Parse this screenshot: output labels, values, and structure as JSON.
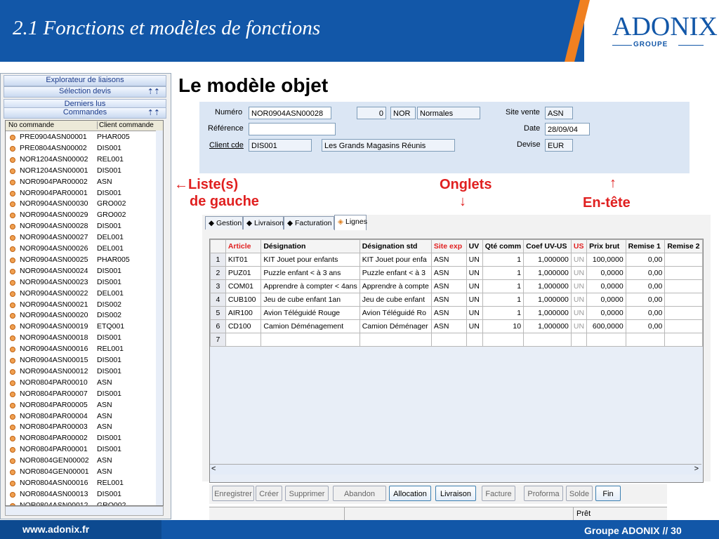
{
  "header": {
    "title": "2.1 Fonctions et modèles de fonctions",
    "logo": "ADONIX",
    "logo_sub": "GROUPE"
  },
  "footer": {
    "url": "www.adonix.fr",
    "right": "Groupe ADONIX // 30"
  },
  "left_panel": {
    "bar1": "Explorateur de liaisons",
    "bar2": "Sélection devis",
    "bar3": "Derniers lus",
    "bar4": "Commandes",
    "columns": [
      "No commande",
      "Client commande"
    ],
    "rows": [
      [
        "PRE0904ASN00001",
        "PHAR005"
      ],
      [
        "PRE0804ASN00002",
        "DIS001"
      ],
      [
        "NOR1204ASN00002",
        "REL001"
      ],
      [
        "NOR1204ASN00001",
        "DIS001"
      ],
      [
        "NOR0904PAR00002",
        "ASN"
      ],
      [
        "NOR0904PAR00001",
        "DIS001"
      ],
      [
        "NOR0904ASN00030",
        "GRO002"
      ],
      [
        "NOR0904ASN00029",
        "GRO002"
      ],
      [
        "NOR0904ASN00028",
        "DIS001"
      ],
      [
        "NOR0904ASN00027",
        "DEL001"
      ],
      [
        "NOR0904ASN00026",
        "DEL001"
      ],
      [
        "NOR0904ASN00025",
        "PHAR005"
      ],
      [
        "NOR0904ASN00024",
        "DIS001"
      ],
      [
        "NOR0904ASN00023",
        "DIS001"
      ],
      [
        "NOR0904ASN00022",
        "DEL001"
      ],
      [
        "NOR0904ASN00021",
        "DIS002"
      ],
      [
        "NOR0904ASN00020",
        "DIS002"
      ],
      [
        "NOR0904ASN00019",
        "ETQ001"
      ],
      [
        "NOR0904ASN00018",
        "DIS001"
      ],
      [
        "NOR0904ASN00016",
        "REL001"
      ],
      [
        "NOR0904ASN00015",
        "DIS001"
      ],
      [
        "NOR0904ASN00012",
        "DIS001"
      ],
      [
        "NOR0804PAR00010",
        "ASN"
      ],
      [
        "NOR0804PAR00007",
        "DIS001"
      ],
      [
        "NOR0804PAR00005",
        "ASN"
      ],
      [
        "NOR0804PAR00004",
        "ASN"
      ],
      [
        "NOR0804PAR00003",
        "ASN"
      ],
      [
        "NOR0804PAR00002",
        "DIS001"
      ],
      [
        "NOR0804PAR00001",
        "DIS001"
      ],
      [
        "NOR0804GEN00002",
        "ASN"
      ],
      [
        "NOR0804GEN00001",
        "ASN"
      ],
      [
        "NOR0804ASN00016",
        "REL001"
      ],
      [
        "NOR0804ASN00013",
        "DIS001"
      ],
      [
        "NOR0804ASN00012",
        "GRO002"
      ]
    ]
  },
  "annotations": {
    "title": "Le modèle objet",
    "left_arrow": "←",
    "left_label_1": "Liste(s)",
    "left_label_2": "de gauche",
    "tabs_label": "Onglets",
    "tabs_arrow": "↓",
    "header_arrow": "↑",
    "header_label": "En-tête"
  },
  "form": {
    "numero_label": "Numéro",
    "numero": "NOR0904ASN00028",
    "zero": "0",
    "site_code": "NOR",
    "site_name": "Normales",
    "reference_label": "Référence",
    "reference": "",
    "client_label": "Client cde",
    "client_code": "DIS001",
    "client_name": "Les Grands Magasins Réunis",
    "site_vente_label": "Site vente",
    "site_vente": "ASN",
    "date_label": "Date",
    "date": "28/09/04",
    "devise_label": "Devise",
    "devise": "EUR"
  },
  "tabs": [
    "Gestion",
    "Livraison",
    "Facturation",
    "Lignes"
  ],
  "grid": {
    "headers": [
      "",
      "Article",
      "Désignation",
      "Désignation std",
      "Site exp",
      "UV",
      "Qté comm",
      "Coef UV-US",
      "US",
      "Prix brut",
      "Remise 1",
      "Remise 2"
    ],
    "rows": [
      [
        "1",
        "KIT01",
        "KIT Jouet pour enfants",
        "KIT Jouet pour enfa",
        "ASN",
        "UN",
        "1",
        "1,000000",
        "UN",
        "100,0000",
        "0,00",
        ""
      ],
      [
        "2",
        "PUZ01",
        "Puzzle enfant < à 3 ans",
        "Puzzle enfant < à 3",
        "ASN",
        "UN",
        "1",
        "1,000000",
        "UN",
        "0,0000",
        "0,00",
        ""
      ],
      [
        "3",
        "COM01",
        "Apprendre à compter < 4ans",
        "Apprendre à compte",
        "ASN",
        "UN",
        "1",
        "1,000000",
        "UN",
        "0,0000",
        "0,00",
        ""
      ],
      [
        "4",
        "CUB100",
        "Jeu de cube enfant 1an",
        "Jeu de cube enfant",
        "ASN",
        "UN",
        "1",
        "1,000000",
        "UN",
        "0,0000",
        "0,00",
        ""
      ],
      [
        "5",
        "AIR100",
        "Avion Téléguidé Rouge",
        "Avion Téléguidé Ro",
        "ASN",
        "UN",
        "1",
        "1,000000",
        "UN",
        "0,0000",
        "0,00",
        ""
      ],
      [
        "6",
        "CD100",
        "Camion Déménagement",
        "Camion Déménager",
        "ASN",
        "UN",
        "10",
        "1,000000",
        "UN",
        "600,0000",
        "0,00",
        ""
      ],
      [
        "7",
        "",
        "",
        "",
        "",
        "",
        "",
        "",
        "",
        "",
        "",
        ""
      ]
    ]
  },
  "buttons": [
    "Enregistrer",
    "Créer",
    "Supprimer",
    "Abandon",
    "Allocation",
    "Livraison",
    "Facture",
    "Proforma",
    "Solde",
    "Fin"
  ],
  "status": {
    "ready": "Prêt"
  }
}
